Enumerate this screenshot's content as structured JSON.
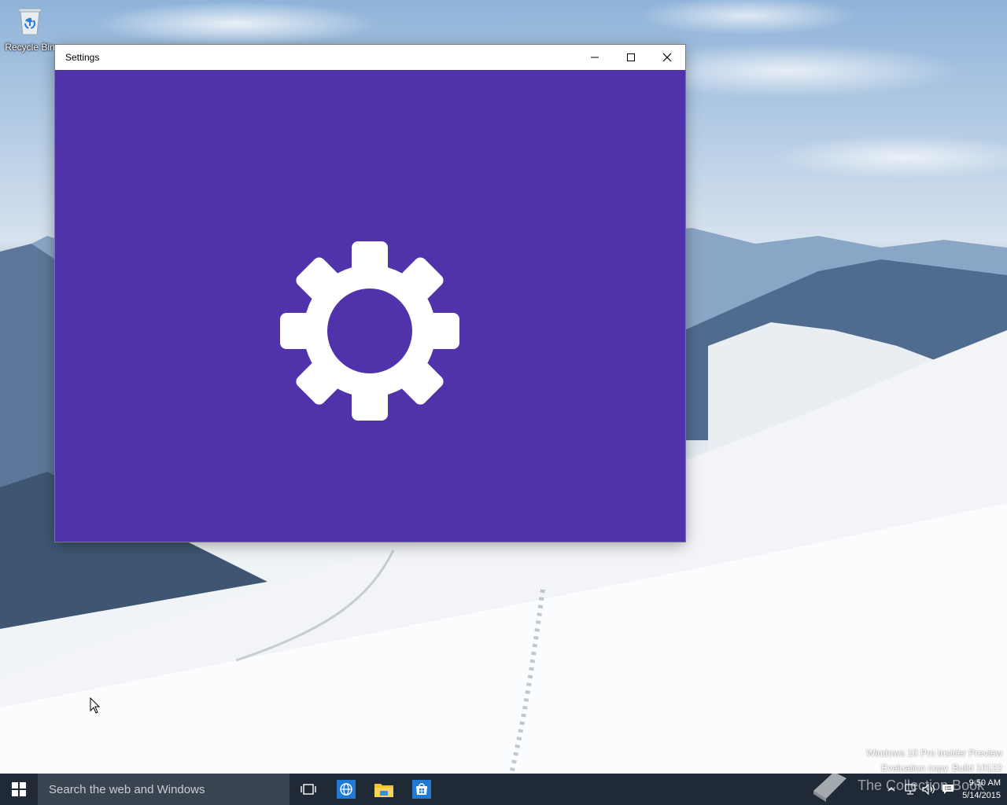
{
  "desktop": {
    "icons": [
      {
        "label": "Recycle Bin",
        "icon": "recycle-bin-icon"
      }
    ]
  },
  "window": {
    "title": "Settings",
    "splash_icon": "gear-icon",
    "splash_color": "#5033aa",
    "controls": {
      "minimize": "minimize-icon",
      "maximize": "maximize-icon",
      "close": "close-icon"
    }
  },
  "watermark": {
    "line1": "Windows 10 Pro Insider Preview",
    "line2": "Evaluation copy. Build 10122"
  },
  "taskbar": {
    "search_placeholder": "Search the web and Windows",
    "pinned": [
      {
        "name": "task-view",
        "icon": "task-view-icon"
      },
      {
        "name": "browser",
        "icon": "globe-icon"
      },
      {
        "name": "file-explorer",
        "icon": "folder-icon"
      },
      {
        "name": "store",
        "icon": "store-icon"
      }
    ],
    "tray": {
      "icons": [
        "chevron-up-icon",
        "network-icon",
        "volume-icon",
        "action-center-icon"
      ]
    },
    "clock": {
      "time": "9:50 AM",
      "date": "5/14/2015"
    }
  },
  "brand_overlay": {
    "text": "The Collection Book"
  }
}
